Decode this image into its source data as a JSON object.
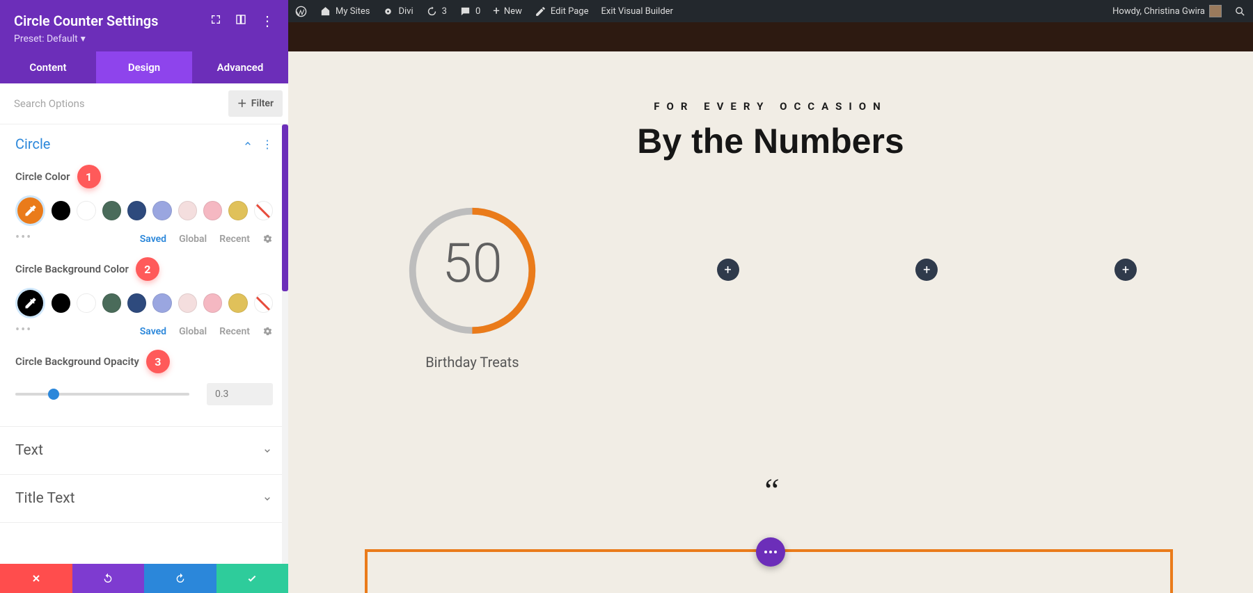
{
  "sidebar": {
    "title": "Circle Counter Settings",
    "preset_label": "Preset: Default",
    "tabs": {
      "content": "Content",
      "design": "Design",
      "advanced": "Advanced"
    },
    "search_placeholder": "Search Options",
    "filter_label": "Filter",
    "sections": {
      "circle": {
        "title": "Circle",
        "circle_color_label": "Circle Color",
        "circle_bg_label": "Circle Background Color",
        "opacity_label": "Circle Background Opacity",
        "opacity_value": "0.3",
        "palette_tabs": {
          "saved": "Saved",
          "global": "Global",
          "recent": "Recent"
        },
        "badge1": "1",
        "badge2": "2",
        "badge3": "3",
        "swatches": [
          {
            "color": "#000000"
          },
          {
            "color": "#ffffff"
          },
          {
            "color": "#4a6b5a"
          },
          {
            "color": "#2e4a7d"
          },
          {
            "color": "#9aa6e0"
          },
          {
            "color": "#f4dede"
          },
          {
            "color": "#f5b8c2"
          },
          {
            "color": "#e0c15a"
          }
        ],
        "dropper1_color": "#ea7b1a",
        "dropper2_color": "#000000"
      },
      "text": {
        "title": "Text"
      },
      "title_text": {
        "title": "Title Text"
      }
    }
  },
  "wpbar": {
    "my_sites": "My Sites",
    "divi": "Divi",
    "sync_count": "3",
    "comments": "0",
    "new": "New",
    "edit_page": "Edit Page",
    "exit_vb": "Exit Visual Builder",
    "howdy": "Howdy, Christina Gwira"
  },
  "page": {
    "subtitle": "FOR EVERY OCCASION",
    "heading": "By the Numbers",
    "counter": {
      "value": "50",
      "title": "Birthday Treats",
      "percent": 50,
      "fg": "#ea7b1a",
      "bg": "#bdbdbd"
    }
  }
}
